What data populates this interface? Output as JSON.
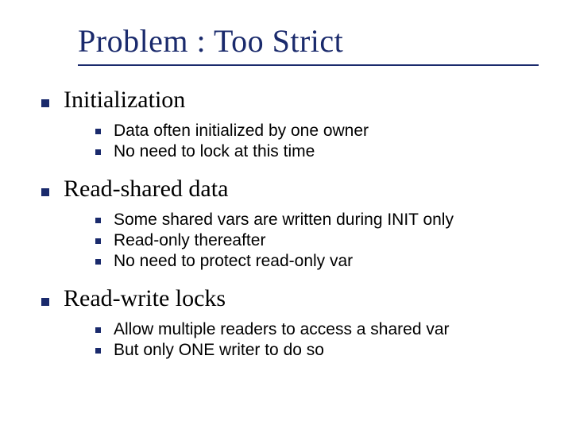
{
  "title": "Problem : Too Strict",
  "sections": [
    {
      "heading": "Initialization",
      "items": [
        "Data often initialized by one owner",
        "No need to lock at this time"
      ]
    },
    {
      "heading": "Read-shared data",
      "items": [
        "Some shared vars are written during INIT only",
        "Read-only thereafter",
        "No need to protect read-only var"
      ]
    },
    {
      "heading": "Read-write locks",
      "items": [
        "Allow multiple readers to access a shared var",
        "But only ONE writer to do so"
      ]
    }
  ]
}
